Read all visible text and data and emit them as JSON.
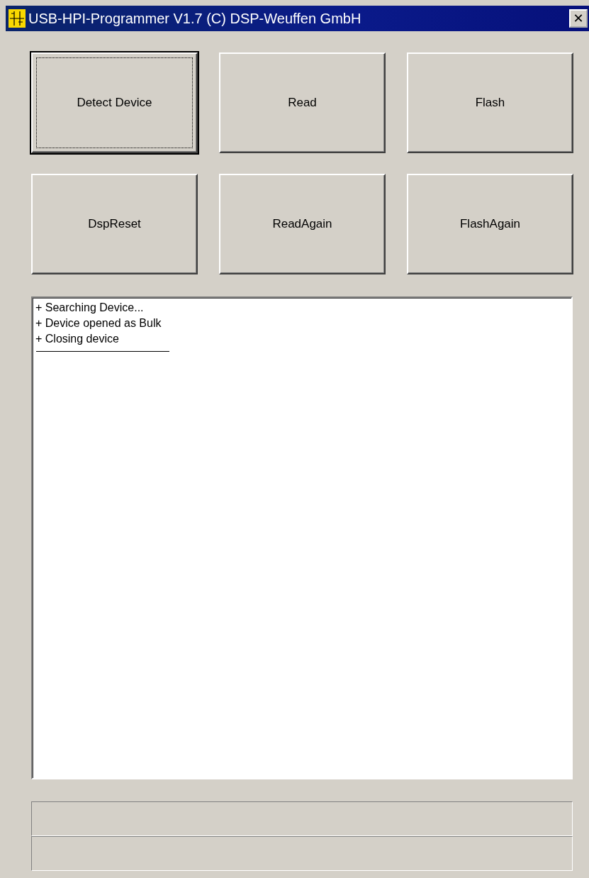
{
  "window": {
    "title": "USB-HPI-Programmer V1.7 (C) DSP-Weuffen GmbH",
    "close": "✕"
  },
  "buttons": [
    {
      "label": "Detect Device",
      "focused": true
    },
    {
      "label": "Read",
      "focused": false
    },
    {
      "label": "Flash",
      "focused": false
    },
    {
      "label": "DspReset",
      "focused": false
    },
    {
      "label": "ReadAgain",
      "focused": false
    },
    {
      "label": "FlashAgain",
      "focused": false
    }
  ],
  "log": [
    {
      "kind": "text",
      "text": "+ Searching Device..."
    },
    {
      "kind": "text",
      "text": "+ Device opened as Bulk"
    },
    {
      "kind": "text",
      "text": "+ Closing device"
    },
    {
      "kind": "separator"
    }
  ]
}
